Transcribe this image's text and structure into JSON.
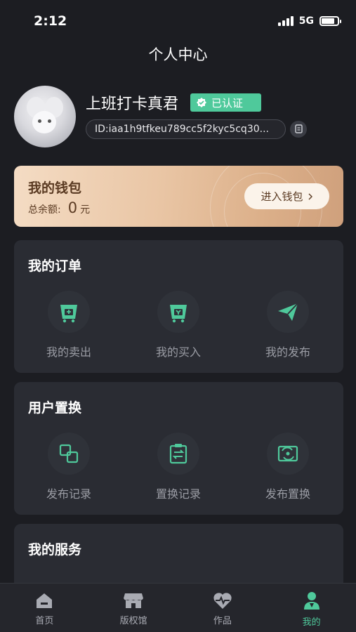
{
  "status": {
    "time": "2:12",
    "network": "5G"
  },
  "header": {
    "title": "个人中心"
  },
  "profile": {
    "username": "上班打卡真君",
    "verified_label": "已认证",
    "id_text": "ID:iaa1h9tfkeu789cc5f2kyc5cq30..."
  },
  "wallet": {
    "title": "我的钱包",
    "balance_label": "总余额:",
    "balance_value": "0",
    "currency": "元",
    "enter_label": "进入钱包"
  },
  "orders": {
    "title": "我的订单",
    "items": [
      {
        "label": "我的卖出",
        "icon": "cart-sell-icon"
      },
      {
        "label": "我的买入",
        "icon": "cart-buy-icon"
      },
      {
        "label": "我的发布",
        "icon": "send-icon"
      }
    ]
  },
  "exchange": {
    "title": "用户置换",
    "items": [
      {
        "label": "发布记录",
        "icon": "squares-icon"
      },
      {
        "label": "置换记录",
        "icon": "clipboard-swap-icon"
      },
      {
        "label": "发布置换",
        "icon": "exchange-icon"
      }
    ]
  },
  "services": {
    "title": "我的服务"
  },
  "tabbar": {
    "items": [
      {
        "label": "首页",
        "icon": "home-icon"
      },
      {
        "label": "版权馆",
        "icon": "store-icon"
      },
      {
        "label": "作品",
        "icon": "heart-pulse-icon"
      },
      {
        "label": "我的",
        "icon": "person-icon",
        "active": true
      }
    ]
  },
  "colors": {
    "accent": "#4fc99b",
    "background": "#1c1d22",
    "card": "#2a2c33"
  }
}
